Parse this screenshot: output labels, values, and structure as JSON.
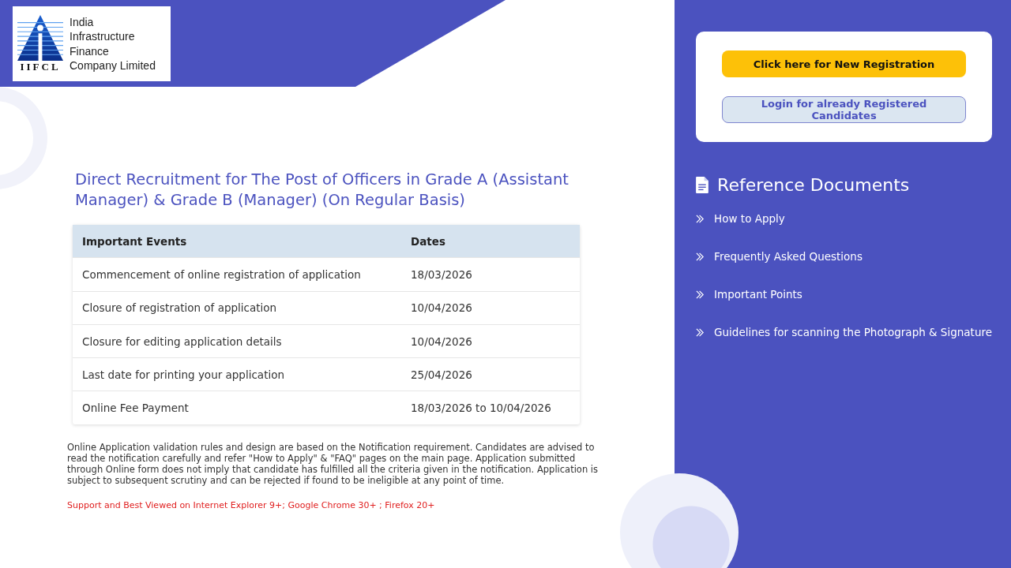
{
  "logo": {
    "abbreviation": "IIFCL",
    "name_lines": [
      "India",
      "Infrastructure",
      "Finance",
      "Company Limited"
    ]
  },
  "title": "Direct Recruitment for The Post of Officers in Grade A (Assistant Manager) & Grade B (Manager) (On Regular Basis)",
  "table": {
    "columns": [
      "Important Events",
      "Dates"
    ],
    "rows": [
      [
        "Commencement of online registration of application",
        "18/03/2026"
      ],
      [
        "Closure of registration of application",
        "10/04/2026"
      ],
      [
        "Closure for editing application details",
        "10/04/2026"
      ],
      [
        "Last date for printing your application",
        "25/04/2026"
      ],
      [
        "Online Fee Payment",
        "18/03/2026 to 10/04/2026"
      ]
    ]
  },
  "note": "Online Application validation rules and design are based on the Notification requirement. Candidates are advised to read the notification carefully and refer \"How to Apply\" & \"FAQ\" pages on the main page. Application submitted through Online form does not imply that candidate has fulfilled all the criteria given in the notification. Application is subject to subsequent scrutiny and can be rejected if found to be ineligible at any point of time.",
  "browser_support": "Support and Best Viewed on Internet Explorer 9+; Google Chrome 30+ ; Firefox 20+",
  "sidebar": {
    "buttons": [
      {
        "kind": "primary",
        "label": "Click here for New Registration"
      },
      {
        "kind": "secondary",
        "label": "Login for already Registered Candidates"
      }
    ],
    "heading": "Reference Documents",
    "links": [
      "How to Apply",
      "Frequently Asked Questions",
      "Important Points",
      "Guidelines for scanning the Photograph & Signature"
    ]
  }
}
